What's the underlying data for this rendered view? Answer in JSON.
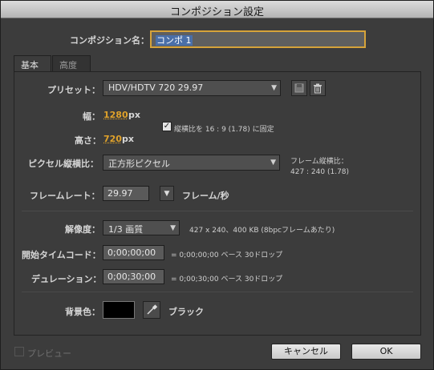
{
  "window": {
    "title": "コンポジション設定"
  },
  "comp_name": {
    "label": "コンポジション名：",
    "value": "コンポ 1"
  },
  "tabs": [
    {
      "label": "基本"
    },
    {
      "label": "高度"
    }
  ],
  "preset": {
    "label": "プリセット：",
    "value": "HDV/HDTV 720 29.97"
  },
  "width": {
    "label": "幅：",
    "value": "1280",
    "unit": "px"
  },
  "height": {
    "label": "高さ：",
    "value": "720",
    "unit": "px"
  },
  "aspect_lock": {
    "checked": true,
    "label": "縦横比を 16 : 9 (1.78) に固定"
  },
  "pixel_aspect": {
    "label": "ピクセル縦横比：",
    "value": "正方形ピクセル"
  },
  "frame_aspect": {
    "label": "フレーム縦横比：",
    "value": "427 : 240 (1.78)"
  },
  "frame_rate": {
    "label": "フレームレート：",
    "value": "29.97",
    "unit": "フレーム/秒"
  },
  "resolution": {
    "label": "解像度：",
    "value": "1/3 画質",
    "info": "427 x 240、400 KB (8bpcフレームあたり)"
  },
  "start_timecode": {
    "label": "開始タイムコード：",
    "value": "0;00;00;00",
    "info": "= 0;00;00;00  ベース 30ドロップ"
  },
  "duration": {
    "label": "デュレーション：",
    "value": "0;00;30;00",
    "info": "= 0;00;30;00  ベース 30ドロップ"
  },
  "background": {
    "label": "背景色：",
    "color_name": "ブラック",
    "color": "#000000"
  },
  "footer": {
    "preview_label": "プレビュー",
    "cancel_label": "キャンセル",
    "ok_label": "OK"
  }
}
